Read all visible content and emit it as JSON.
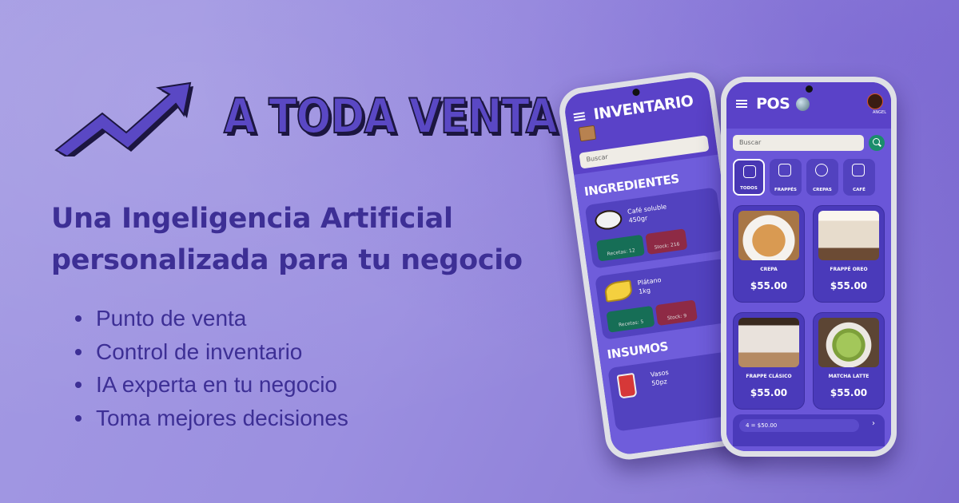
{
  "brand": {
    "title": "A TODA VENTA"
  },
  "headline": {
    "line1": "Una Ingeligencia Artificial",
    "line2": "personalizada para tu negocio"
  },
  "features": [
    "Punto de venta",
    "Control de inventario",
    "IA experta en tu negocio",
    "Toma mejores decisiones"
  ],
  "inventory_app": {
    "title": "INVENTARIO",
    "search_placeholder": "Buscar",
    "ingredients_heading": "INGREDIENTES",
    "items": [
      {
        "name": "Café soluble",
        "qty": "450gr",
        "recipes": "Recetas: 12",
        "stock": "Stock: 216"
      },
      {
        "name": "Plátano",
        "qty": "1kg",
        "recipes": "Recetas: 5",
        "stock": "Stock: 9"
      }
    ],
    "supplies_heading": "INSUMOS",
    "supply": {
      "name": "Vasos",
      "qty": "50pz"
    }
  },
  "pos_app": {
    "title": "POS",
    "user": "ANGEL",
    "search_placeholder": "Buscar",
    "categories": [
      "TODOS",
      "FRAPPÉS",
      "CREPAS",
      "CAFÉ"
    ],
    "products": [
      {
        "name": "CREPA",
        "price": "$55.00"
      },
      {
        "name": "FRAPPÉ OREO",
        "price": "$55.00"
      },
      {
        "name": "FRAPPE CLÁSICO",
        "price": "$55.00"
      },
      {
        "name": "MATCHA LATTE",
        "price": "$55.00"
      }
    ],
    "cart_summary": "4 = $50.00",
    "cart_arrow": "›"
  },
  "colors": {
    "accent": "#5a48c4",
    "text": "#3d2f95",
    "app_purple": "#5a42c8",
    "green": "#1a8d6b"
  }
}
